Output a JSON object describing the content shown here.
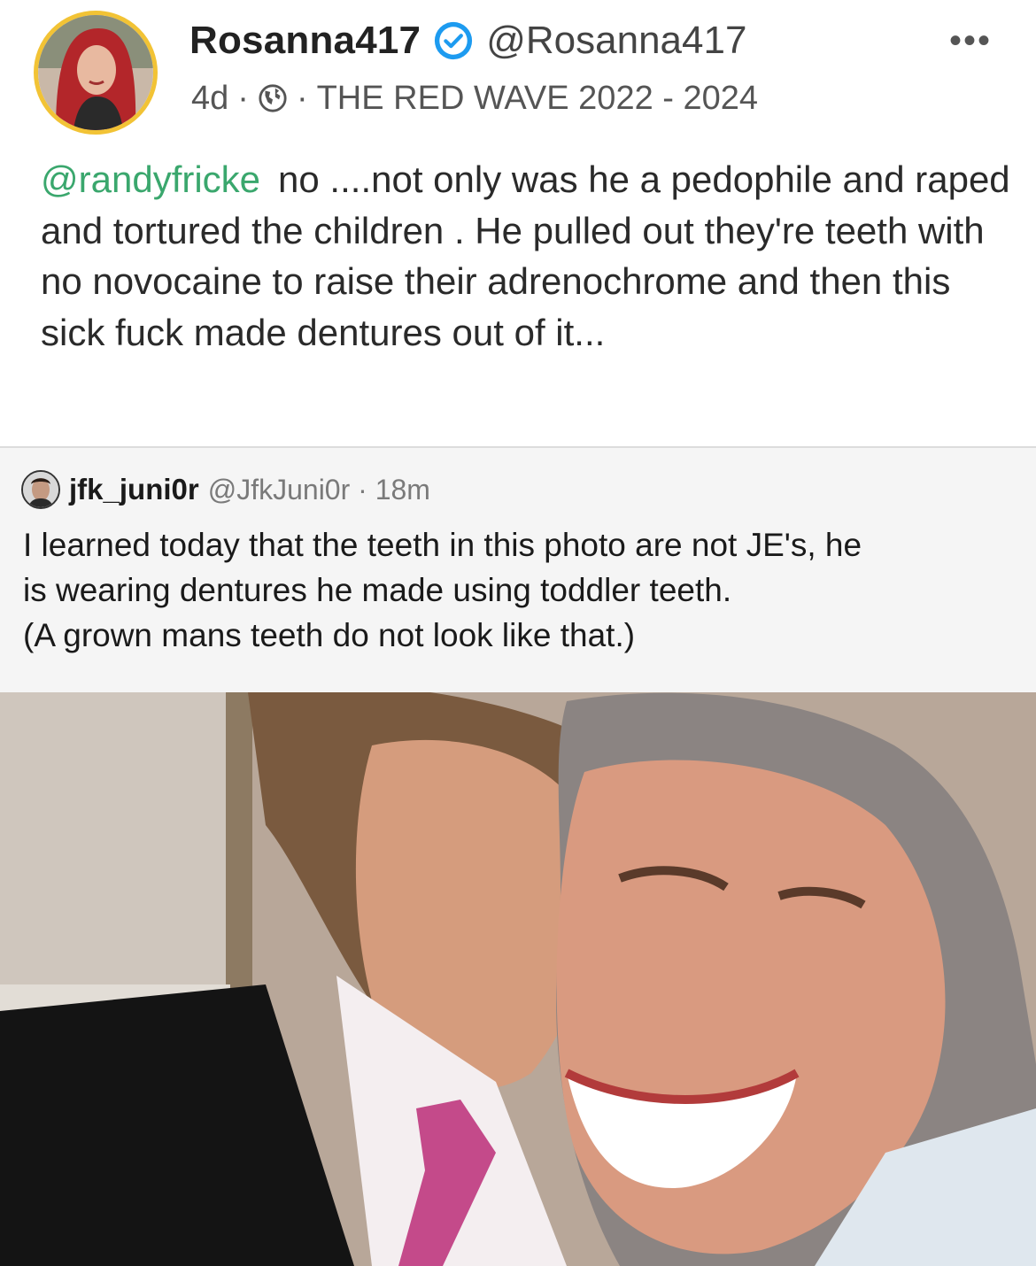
{
  "post": {
    "display_name": "Rosanna417",
    "handle": "@Rosanna417",
    "time": "4d",
    "sep1": "·",
    "sep2": "·",
    "group": "THE RED WAVE 2022 - 2024",
    "more": "•••",
    "mention": "@randyfricke",
    "text": "no ....not only was he a pedophile and raped and tortured the children . He pulled out they're teeth with no novocaine to raise their adrenochrome and then this sick fuck made dentures out of it..."
  },
  "quote": {
    "display_name": "jfk_juni0r",
    "handle_time": "@JfkJuni0r · 18m",
    "lines": [
      "I learned today that the teeth in this photo are not JE's, he",
      "is wearing dentures he made using toddler teeth.",
      "(A grown mans teeth do not look like that.)"
    ]
  },
  "icons": {
    "verified": "verified-badge-icon",
    "globe": "globe-icon",
    "more": "more-options-icon"
  },
  "colors": {
    "mention": "#3aa76d",
    "verified": "#1d9bf0",
    "avatar_ring": "#f2c335"
  }
}
